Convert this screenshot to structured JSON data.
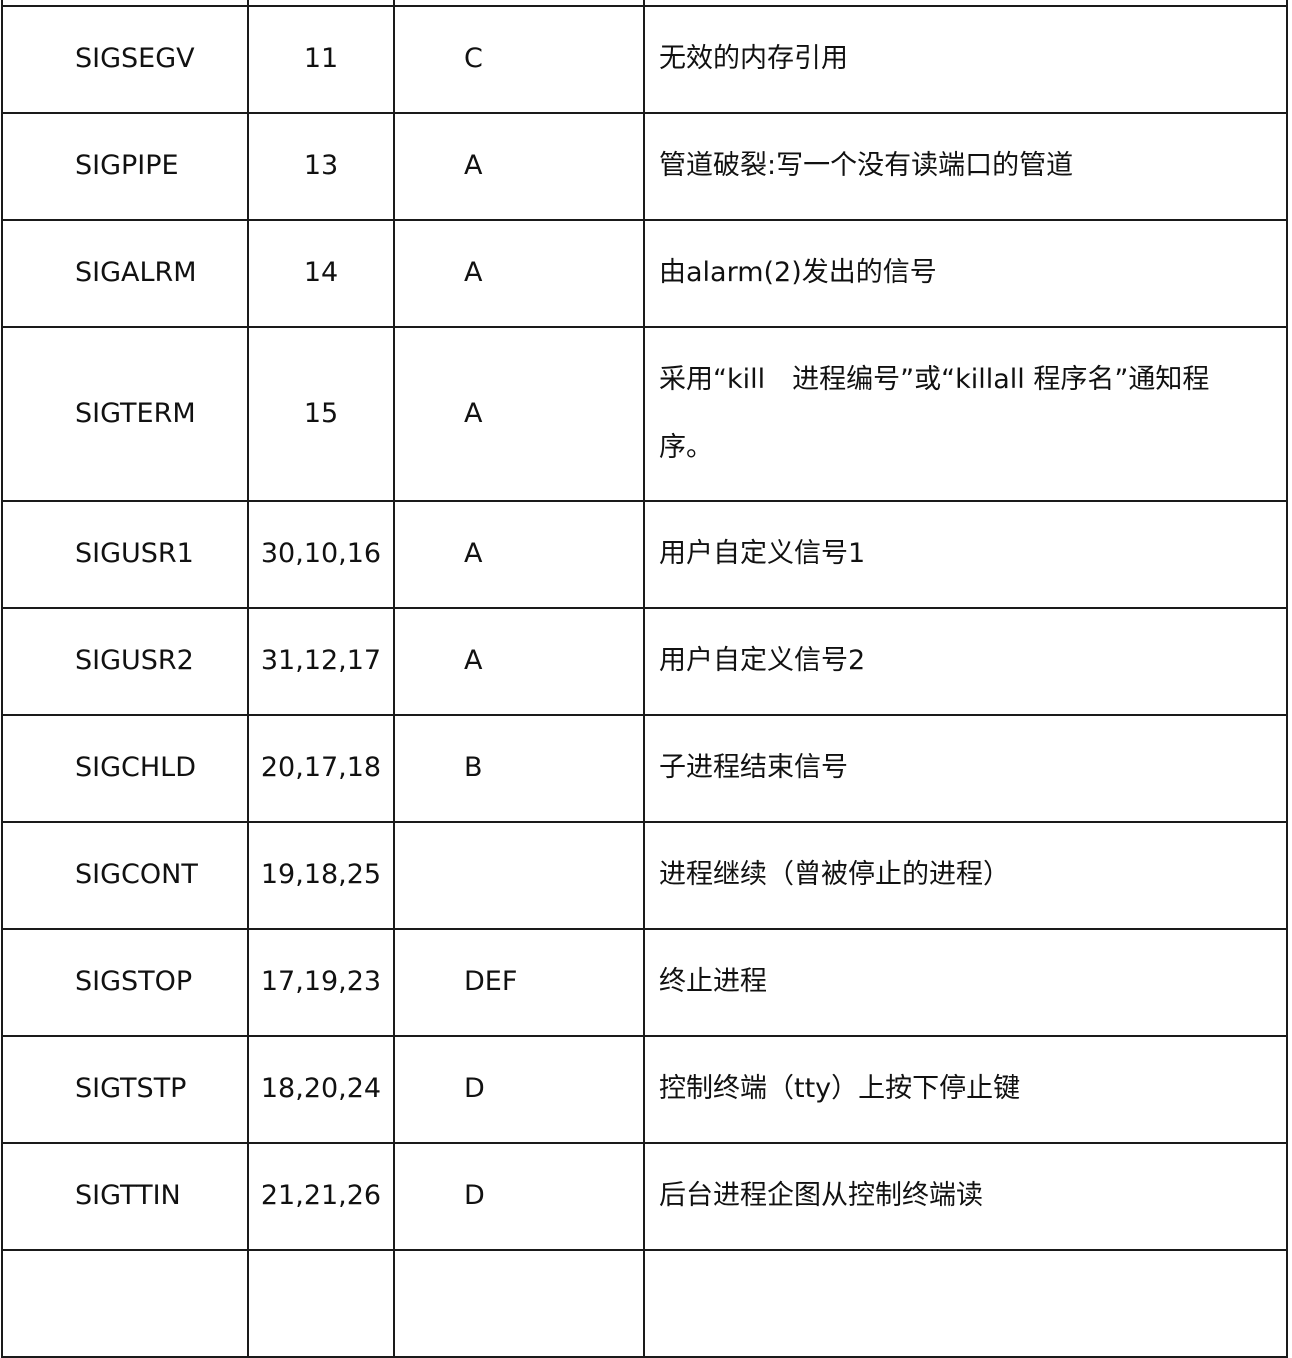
{
  "table": {
    "rows": [
      {
        "name": "",
        "num": "",
        "action": "",
        "desc": ""
      },
      {
        "name": "SIGSEGV",
        "num": "11",
        "action": "C",
        "desc": "无效的内存引用"
      },
      {
        "name": "SIGPIPE",
        "num": "13",
        "action": "A",
        "desc": "管道破裂:写一个没有读端口的管道"
      },
      {
        "name": "SIGALRM",
        "num": "14",
        "action": "A",
        "desc": "由alarm(2)发出的信号"
      },
      {
        "name": "SIGTERM",
        "num": "15",
        "action": "A",
        "desc": "采用“kill　进程编号”或“killall 程序名”通知程序。"
      },
      {
        "name": "SIGUSR1",
        "num": "30,10,16",
        "action": "A",
        "desc": "用户自定义信号1"
      },
      {
        "name": "SIGUSR2",
        "num": "31,12,17",
        "action": "A",
        "desc": "用户自定义信号2"
      },
      {
        "name": "SIGCHLD",
        "num": "20,17,18",
        "action": "B",
        "desc": "子进程结束信号"
      },
      {
        "name": "SIGCONT",
        "num": "19,18,25",
        "action": "",
        "desc": "进程继续（曾被停止的进程）"
      },
      {
        "name": "SIGSTOP",
        "num": "17,19,23",
        "action": "DEF",
        "desc": "终止进程"
      },
      {
        "name": "SIGTSTP",
        "num": "18,20,24",
        "action": "D",
        "desc": "控制终端（tty）上按下停止键"
      },
      {
        "name": "SIGTTIN",
        "num": "21,21,26",
        "action": "D",
        "desc": "后台进程企图从控制终端读"
      },
      {
        "name": "",
        "num": "",
        "action": "",
        "desc": ""
      }
    ]
  }
}
